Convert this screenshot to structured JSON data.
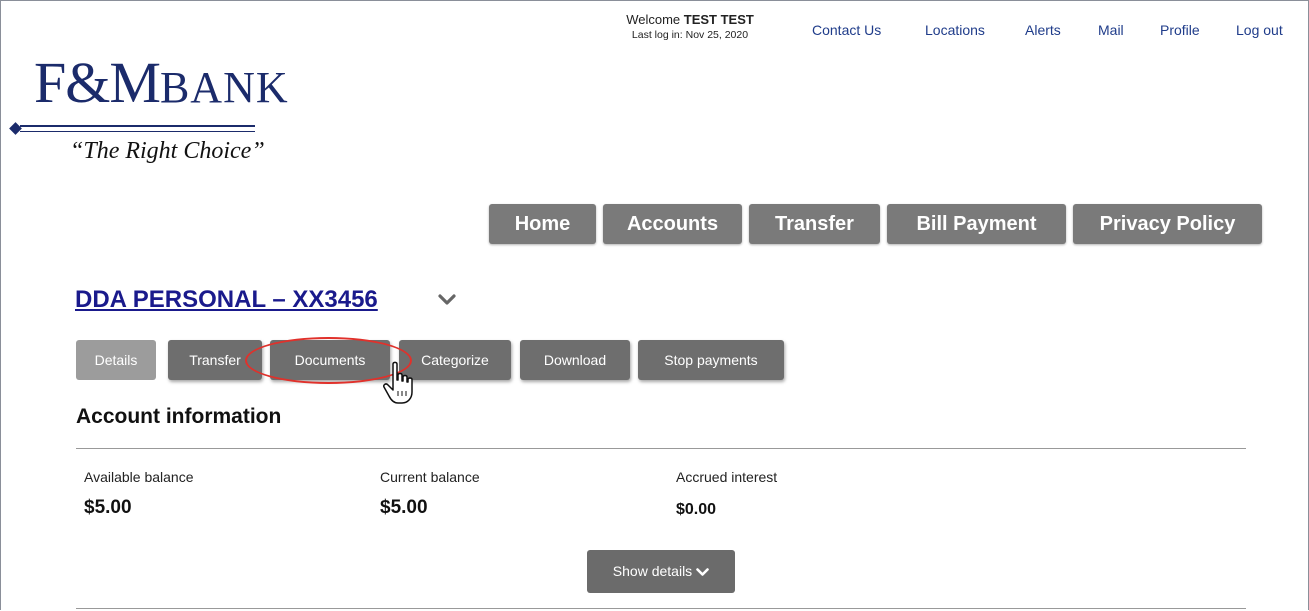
{
  "header": {
    "welcome_prefix": "Welcome ",
    "welcome_name": "TEST TEST",
    "last_login": "Last log in: Nov 25, 2020",
    "links": [
      "Contact Us",
      "Locations",
      "Alerts",
      "Mail",
      "Profile",
      "Log out"
    ]
  },
  "logo": {
    "brand_main": "F&M",
    "brand_bank": "BANK",
    "tagline": "“The Right Choice”"
  },
  "nav": {
    "items": [
      "Home",
      "Accounts",
      "Transfer",
      "Bill Payment",
      "Privacy Policy"
    ]
  },
  "account": {
    "title": "DDA PERSONAL – XX3456 ",
    "tabs": [
      "Details",
      "Transfer",
      "Documents",
      "Categorize",
      "Download",
      "Stop payments"
    ],
    "active_tab": "Details",
    "section_title": "Account information",
    "balances": [
      {
        "label": "Available balance",
        "value": "$5.00"
      },
      {
        "label": "Current balance",
        "value": "$5.00"
      },
      {
        "label": "Accrued interest",
        "value": "$0.00"
      }
    ],
    "show_details_label": "Show details"
  },
  "colors": {
    "link": "#1f3c8a",
    "brand": "#1b2b6b",
    "title": "#1a1a8c",
    "button": "#7a7a7a",
    "highlight": "#e0312b"
  },
  "icons": {
    "account_dropdown": "chevron-down-icon",
    "show_details": "chevron-down-icon",
    "cursor": "hand-pointer-icon"
  }
}
